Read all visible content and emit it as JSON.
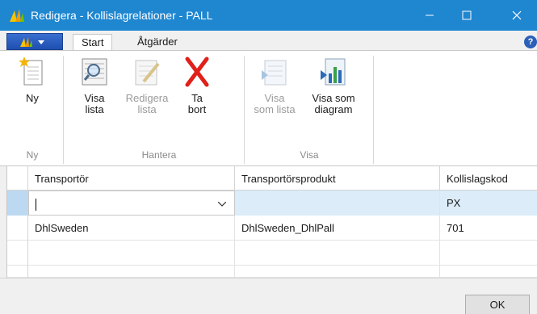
{
  "window": {
    "title": "Redigera - Kollislagrelationer - PALL",
    "minimize_icon": "minimize-icon",
    "maximize_icon": "maximize-icon",
    "close_icon": "close-icon"
  },
  "ribbon_tabs": {
    "app_menu_icon": "app-menu-icon",
    "tabs": [
      {
        "label": "Start",
        "active": true
      },
      {
        "label": "Åtgärder",
        "active": false
      }
    ],
    "help_label": "?"
  },
  "ribbon": {
    "groups": [
      {
        "label": "Ny",
        "buttons": [
          {
            "label": "Ny",
            "icon": "new-document-icon",
            "enabled": true
          }
        ]
      },
      {
        "label": "Hantera",
        "buttons": [
          {
            "label": "Visa\nlista",
            "icon": "view-list-icon",
            "enabled": true
          },
          {
            "label": "Redigera\nlista",
            "icon": "edit-list-icon",
            "enabled": false
          },
          {
            "label": "Ta\nbort",
            "icon": "delete-icon",
            "enabled": true
          }
        ]
      },
      {
        "label": "Visa",
        "buttons": [
          {
            "label": "Visa\nsom lista",
            "icon": "show-as-list-icon",
            "enabled": false
          },
          {
            "label": "Visa som\ndiagram",
            "icon": "show-as-chart-icon",
            "enabled": true
          }
        ]
      }
    ]
  },
  "grid": {
    "columns": [
      "Transportör",
      "Transportörsprodukt",
      "Kollislagskod"
    ],
    "new_row": {
      "transportor": "",
      "transportorsprodukt": "",
      "kollislagskod": "PX"
    },
    "rows": [
      {
        "transportor": "DhlSweden",
        "transportorsprodukt": "DhlSweden_DhlPall",
        "kollislagskod": "701"
      }
    ]
  },
  "footer": {
    "ok_label": "OK"
  }
}
